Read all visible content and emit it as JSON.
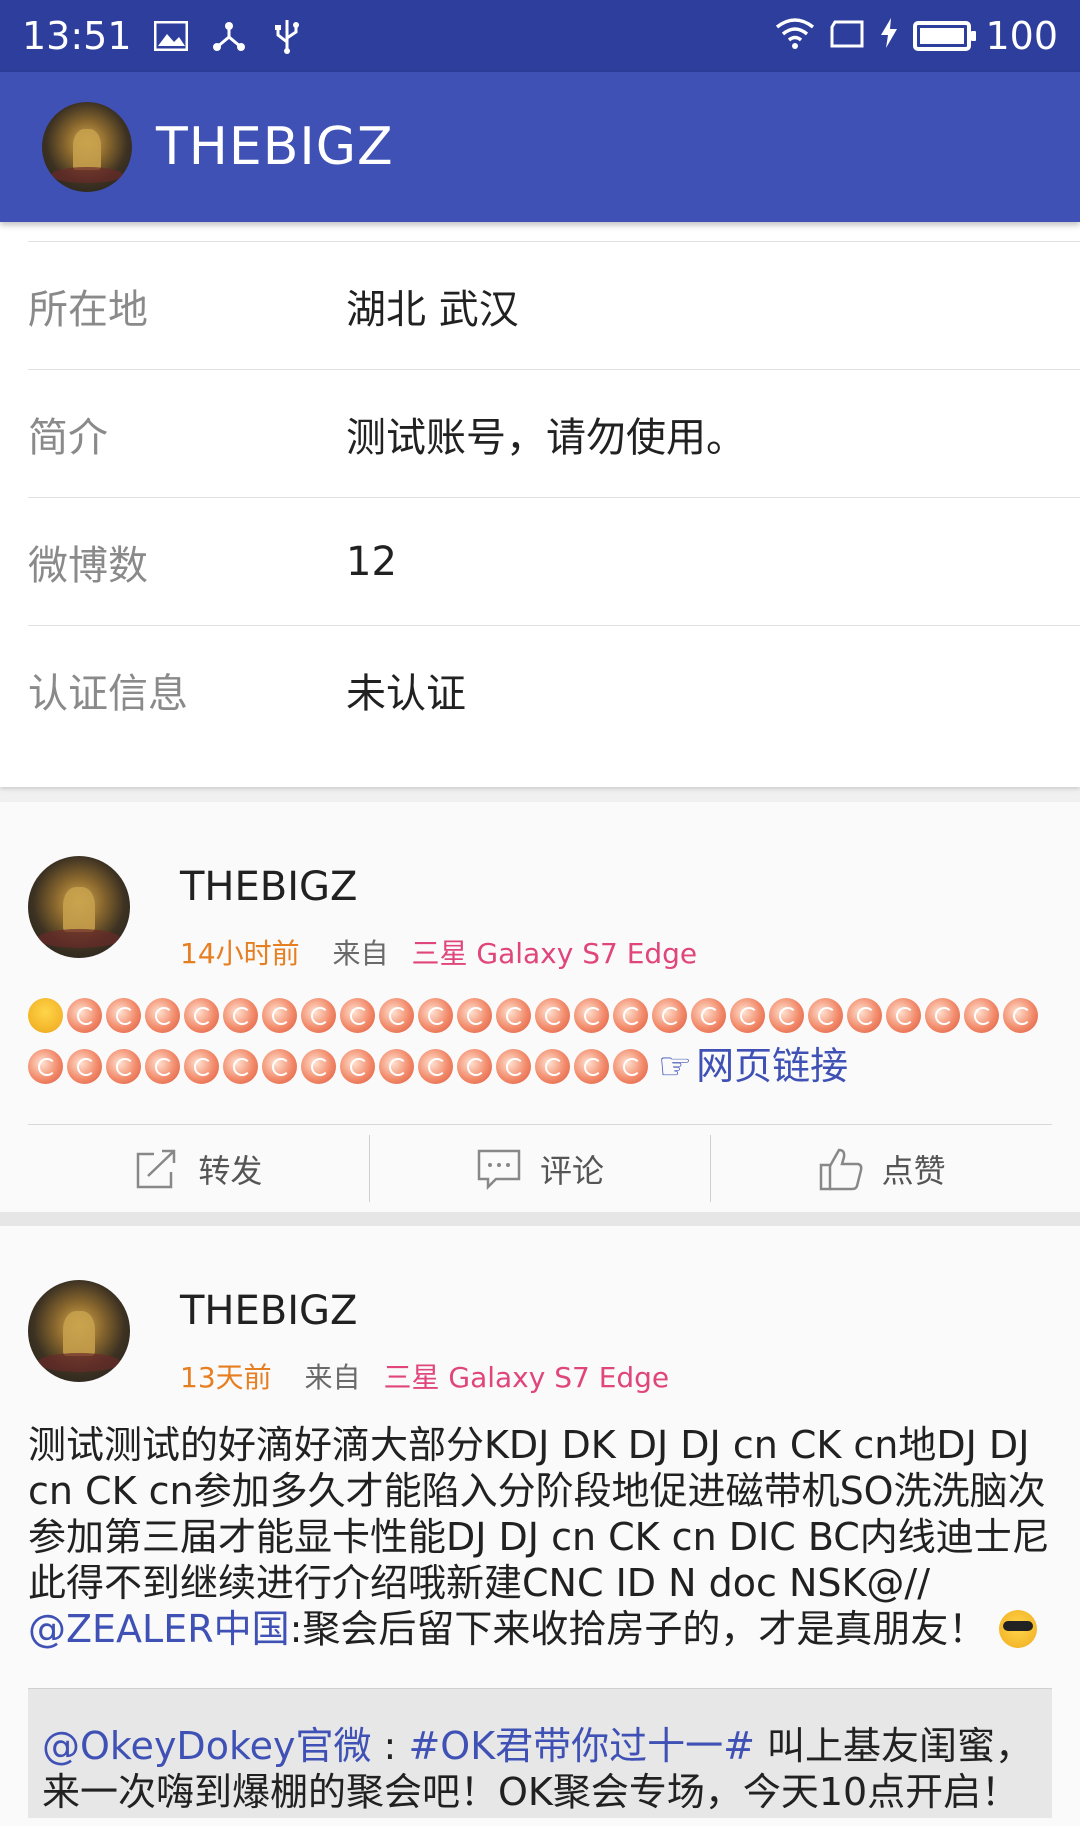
{
  "status_bar": {
    "time": "13:51",
    "battery": "100",
    "battery_level": 1.0
  },
  "app_bar": {
    "title": "THEBIGZ"
  },
  "profile_info": {
    "rows": [
      {
        "label": "所在地",
        "value": "湖北 武汉"
      },
      {
        "label": "简介",
        "value": "测试账号，请勿使用。"
      },
      {
        "label": "微博数",
        "value": "12"
      },
      {
        "label": "认证信息",
        "value": "未认证"
      }
    ]
  },
  "posts": [
    {
      "author": "THEBIGZ",
      "time": "14小时前",
      "from_label": "来自",
      "device": "三星 Galaxy S7 Edge",
      "link_icon": "☞",
      "link_text": "网页链接",
      "emoji_first": "laugh-cry",
      "emoji_repeat": "shrimp"
    },
    {
      "author": "THEBIGZ",
      "time": "13天前",
      "from_label": "来自",
      "device": "三星 Galaxy S7 Edge",
      "text": "测试测试的好滴好滴大部分KDJ DK DJ DJ cn CK cn地DJ DJ cn CK cn参加多久才能陷入分阶段地促进磁带机SO洗洗脑次参加第三届才能显卡性能DJ DJ cn CK cn DIC BC内线迪士尼此得不到继续进行介绍哦新建CNC ID N doc NSK@//",
      "mention": "@ZEALER中国",
      "text_after": ":聚会后留下来收拾房子的，才是真朋友！",
      "quote_mention": "@OkeyDokey官微",
      "quote_colon": " : ",
      "quote_topic": "#OK君带你过十一#",
      "quote_text": " 叫上基友闺蜜，来一次嗨到爆棚的聚会吧！OK聚会专场，今天10点开启！"
    }
  ],
  "actions": {
    "repost": "转发",
    "comment": "评论",
    "like": "点赞"
  }
}
